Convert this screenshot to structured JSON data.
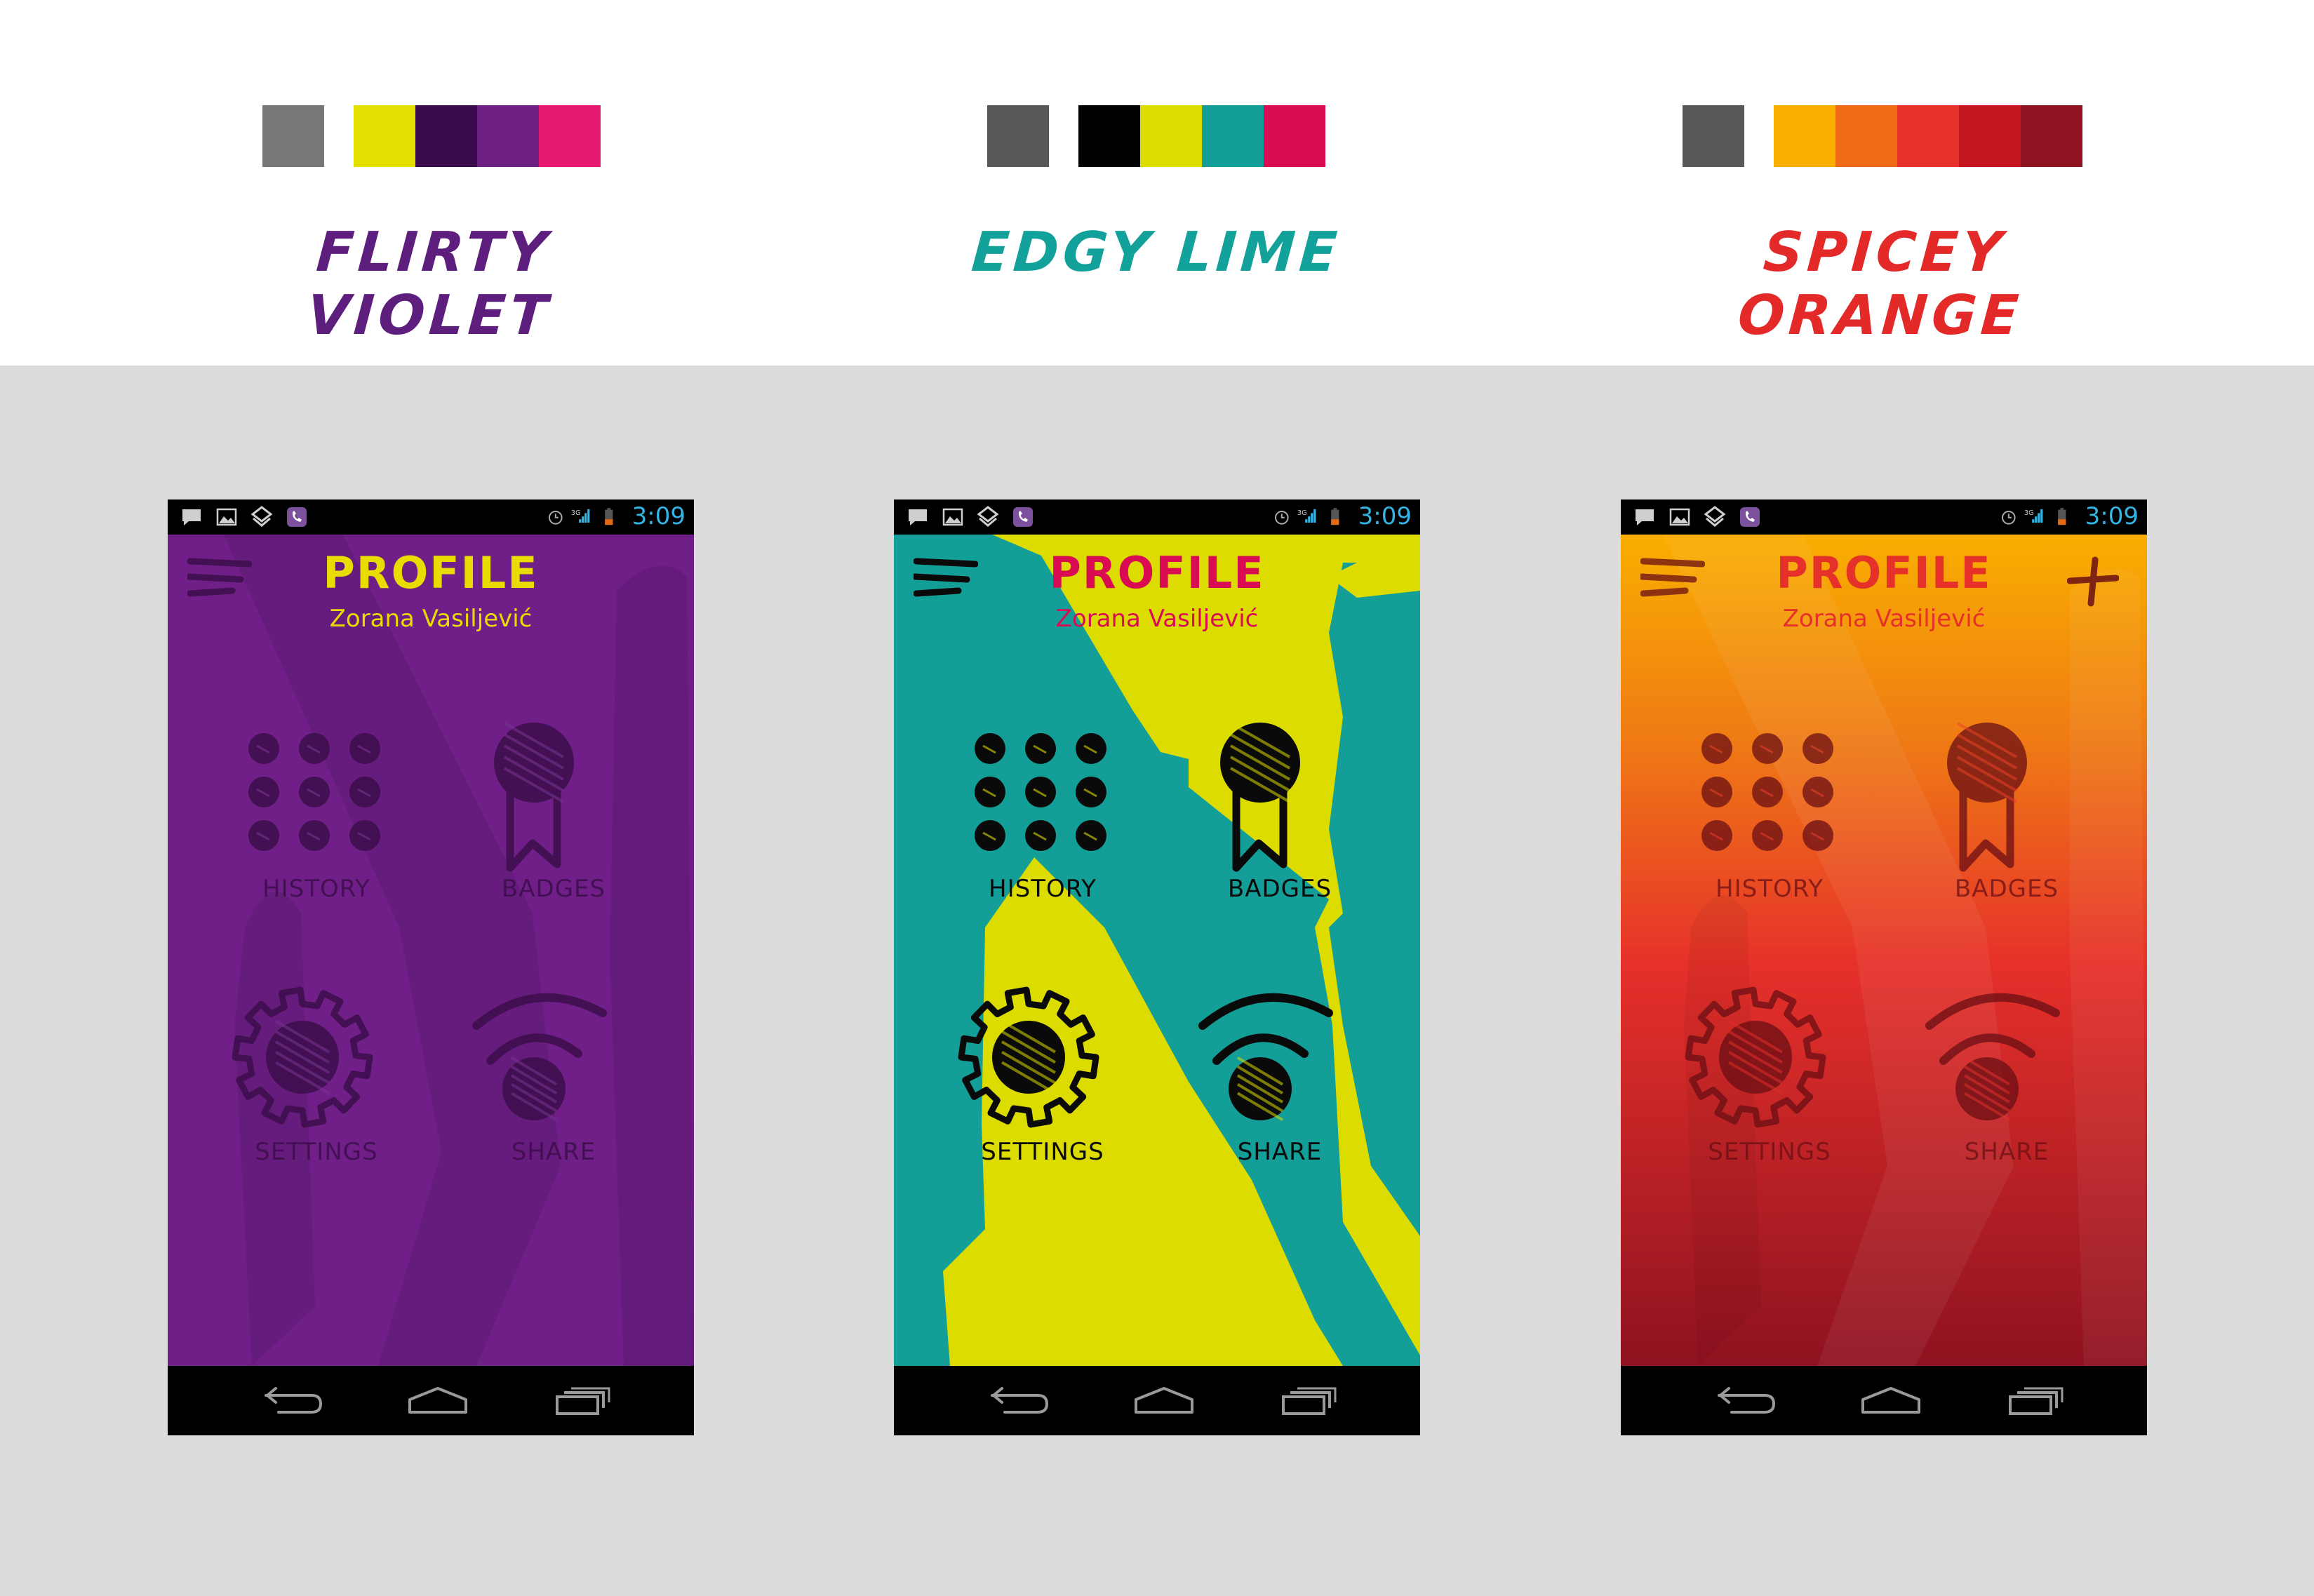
{
  "themes": [
    {
      "name": "FLIRTY VIOLET",
      "name_color": "#5e1e7e",
      "swatches": [
        "#777777",
        "#e4e000",
        "#3b0b4b",
        "#6e1f83",
        "#e5196f"
      ],
      "screen": {
        "bg_light": "#6f1f87",
        "bg_dark": "#5c1872",
        "bg_gradient": false,
        "title": "PROFILE",
        "subtitle": "Zorana Vasiljević",
        "title_color": "#e8dc00",
        "subtitle_color": "#e8dc00",
        "icon_color": "#3a0d48",
        "label_color": "#3a0d48",
        "icon_opacity": 0.8,
        "show_plus": false
      }
    },
    {
      "name": "EDGY LIME",
      "name_color": "#13a29b",
      "swatches": [
        "#585858",
        "#000000",
        "#dcdc00",
        "#139e98",
        "#d90b52"
      ],
      "screen": {
        "bg_light": "#139e98",
        "bg_dark": "#dcdc00",
        "bg_gradient": false,
        "two_tone": true,
        "title": "PROFILE",
        "subtitle": "Zorana Vasiljević",
        "title_color": "#d90b52",
        "subtitle_color": "#d90b52",
        "icon_color": "#0a0a0a",
        "label_color": "#0a0a0a",
        "icon_opacity": 1,
        "show_plus": false
      }
    },
    {
      "name": "SPICEY ORANGE",
      "name_color": "#e32a29",
      "swatches": [
        "#585858",
        "#f9ae00",
        "#ee6a17",
        "#e6302a",
        "#c3161f",
        "#8e1220"
      ],
      "screen": {
        "bg_top": "#f9ae00",
        "bg_mid": "#e6302a",
        "bg_bottom": "#8e1220",
        "bg_gradient": true,
        "title": "PROFILE",
        "subtitle": "Zorana Vasiljević",
        "title_color": "#e6302a",
        "subtitle_color": "#e6302a",
        "icon_color": "#6a0e14",
        "label_color": "#6a0e14",
        "icon_opacity": 0.75,
        "show_plus": true
      }
    }
  ],
  "menu": [
    {
      "key": "history",
      "label": "HISTORY",
      "icon": "history-grid-icon"
    },
    {
      "key": "badges",
      "label": "BADGES",
      "icon": "badge-ribbon-icon"
    },
    {
      "key": "settings",
      "label": "SETTINGS",
      "icon": "gear-icon"
    },
    {
      "key": "share",
      "label": "SHARE",
      "icon": "share-signal-icon"
    }
  ],
  "status_bar": {
    "time": "3:09",
    "network": "3G",
    "left_icons": [
      "message-icon",
      "image-icon",
      "download-icon",
      "viber-icon"
    ],
    "right_icons": [
      "alarm-icon",
      "signal-icon",
      "battery-icon"
    ]
  },
  "nav_bar": [
    "back-icon",
    "home-icon",
    "recent-apps-icon"
  ]
}
